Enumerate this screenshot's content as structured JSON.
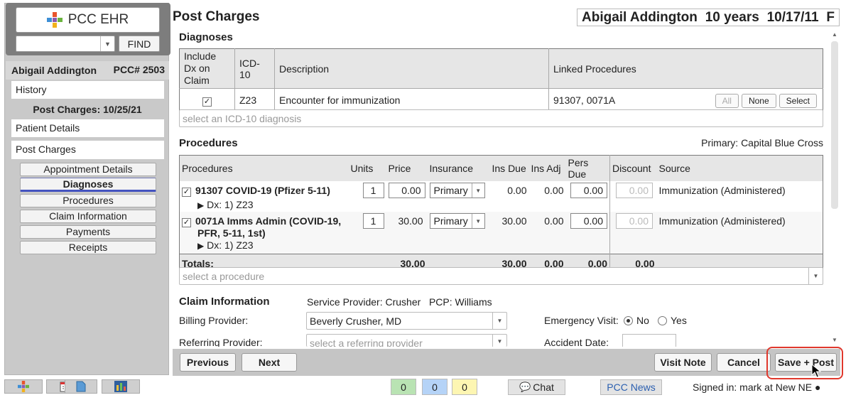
{
  "app": {
    "title": "PCC EHR",
    "find_label": "FIND"
  },
  "patient": {
    "name": "Abigail Addington",
    "pcc_number": "PCC# 2503",
    "age": "10 years",
    "dob": "10/17/11",
    "sex": "F"
  },
  "sidebar": {
    "history": "History",
    "post_charges_date": "Post Charges: 10/25/21",
    "patient_details": "Patient Details",
    "post_charges": "Post Charges",
    "subitems": [
      "Appointment Details",
      "Diagnoses",
      "Procedures",
      "Claim Information",
      "Payments",
      "Receipts"
    ],
    "active_subitem": "Diagnoses"
  },
  "main": {
    "title": "Post Charges"
  },
  "diagnoses": {
    "heading": "Diagnoses",
    "columns": [
      "Include Dx on Claim",
      "ICD-10",
      "Description",
      "Linked Procedures"
    ],
    "rows": [
      {
        "include": "✓",
        "icd10": "Z23",
        "description": "Encounter for immunization",
        "linked": "91307, 0071A"
      }
    ],
    "buttons": {
      "all": "All",
      "none": "None",
      "select": "Select"
    },
    "placeholder": "select an ICD-10 diagnosis"
  },
  "procedures": {
    "heading": "Procedures",
    "primary_label": "Primary: Capital Blue Cross",
    "columns": [
      "Procedures",
      "Units",
      "Price",
      "Insurance",
      "Ins Due",
      "Ins Adj",
      "Pers Due",
      "Discount",
      "Source"
    ],
    "rows": [
      {
        "check": "✓",
        "name": "91307 COVID-19 (Pfizer 5-11)",
        "name2": "",
        "dx": "Dx:  1) Z23",
        "units": "1",
        "price": "0.00",
        "insurance": "Primary",
        "ins_due": "0.00",
        "ins_adj": "0.00",
        "pers_due": "0.00",
        "discount": "0.00",
        "source": "Immunization (Administered)"
      },
      {
        "check": "✓",
        "name": "0071A Imms Admin (COVID-19,",
        "name2": "PFR, 5-11, 1st)",
        "dx": "Dx:  1) Z23",
        "units": "1",
        "price": "30.00",
        "insurance": "Primary",
        "ins_due": "30.00",
        "ins_adj": "0.00",
        "pers_due": "0.00",
        "discount": "0.00",
        "source": "Immunization (Administered)"
      }
    ],
    "totals": {
      "label": "Totals:",
      "price": "30.00",
      "ins_due": "30.00",
      "ins_adj": "0.00",
      "pers_due": "0.00",
      "discount": "0.00"
    },
    "placeholder": "select a procedure"
  },
  "claim": {
    "heading": "Claim Information",
    "service_provider_label": "Service Provider:",
    "service_provider": "Crusher",
    "pcp_label": "PCP:",
    "pcp": "Williams",
    "billing_provider_label": "Billing Provider:",
    "billing_provider": "Beverly Crusher, MD",
    "referring_provider_label": "Referring Provider:",
    "referring_placeholder": "select a referring provider",
    "emergency_label": "Emergency Visit:",
    "emergency_no": "No",
    "emergency_yes": "Yes",
    "emergency_value": "No",
    "accident_label": "Accident Date:"
  },
  "footer": {
    "previous": "Previous",
    "next": "Next",
    "visit_note": "Visit Note",
    "cancel": "Cancel",
    "save_post": "Save + Post"
  },
  "status": {
    "counts": [
      "0",
      "0",
      "0"
    ],
    "count_colors": [
      "#b9e3b3",
      "#b5d3f7",
      "#fdf6b2"
    ],
    "chat": "Chat",
    "news": "PCC News",
    "signed_in": "Signed in: mark at New NE ●"
  },
  "icons": [
    "pcc-logo-icon",
    "calendar-icon",
    "document-icon",
    "chart-icon",
    "chat-icon",
    "cursor-icon"
  ]
}
